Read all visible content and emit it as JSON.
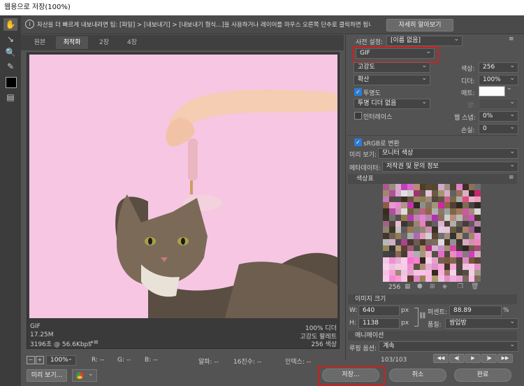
{
  "window": {
    "title": "웹용으로 저장(100%)"
  },
  "info": {
    "text": "자산을 더 빠르게 내보내려면 팁: [파일] > [내보내기] > [내보내기 형식...]을 사용하거나 레이어를 마우스 오른쪽 단추로 클릭하면 됩니다.",
    "learn_more": "자세히 알아보기"
  },
  "tabs": [
    {
      "label": "원본"
    },
    {
      "label": "최적화"
    },
    {
      "label": "2장"
    },
    {
      "label": "4장"
    }
  ],
  "image_info": {
    "format": "GIF",
    "size": "17.25M",
    "time": "3196초 @ 56.6Kbps",
    "time_menu": "→≡",
    "dither_pct": "100% 디더",
    "palette_name": "고강도 팔레트",
    "colors": "256 색상"
  },
  "statusbar": {
    "zoom": "100%",
    "r": "R: --",
    "g": "G: --",
    "b": "B: --",
    "alpha": "알파: --",
    "hex": "16진수: --",
    "index": "인덱스: --"
  },
  "footer": {
    "preview": "미리 보기...",
    "save": "저장...",
    "cancel": "취소",
    "done": "완료"
  },
  "settings": {
    "preset_label": "사전 설정:",
    "preset_value": "[이름 없음]",
    "format_value": "GIF",
    "reduction": "고강도",
    "colors_label": "색상:",
    "colors_value": "256",
    "dither_algo": "확산",
    "dither_label": "디더:",
    "dither_value": "100%",
    "transparency": "투명도",
    "matte_label": "매트:",
    "trans_dither": "투명 디더 없음",
    "amount_label": "양:",
    "interlace": "인터레이스",
    "web_snap_label": "웹 스냅:",
    "web_snap_value": "0%",
    "lossy_label": "손실:",
    "lossy_value": "0",
    "srgb": "sRGB로 변환",
    "preview_label": "미리 보기:",
    "preview_value": "모니터 색상",
    "metadata_label": "메타데이터:",
    "metadata_value": "저작권 및 문의 정보"
  },
  "color_table": {
    "title": "색상표",
    "count": "256"
  },
  "image_size": {
    "title": "이미지 크기",
    "w_label": "W:",
    "w_value": "640",
    "h_label": "H:",
    "h_value": "1138",
    "unit": "px",
    "percent_label": "퍼센트:",
    "percent_value": "88.89",
    "percent_unit": "%",
    "quality_label": "품질:",
    "quality_value": "쌍입방"
  },
  "animation": {
    "title": "애니메이션",
    "loop_label": "루핑 옵션:",
    "loop_value": "계속",
    "frame": "103/103"
  },
  "colors": {
    "accent_red": "#d01f1f",
    "bg": "#f6c6e3"
  }
}
